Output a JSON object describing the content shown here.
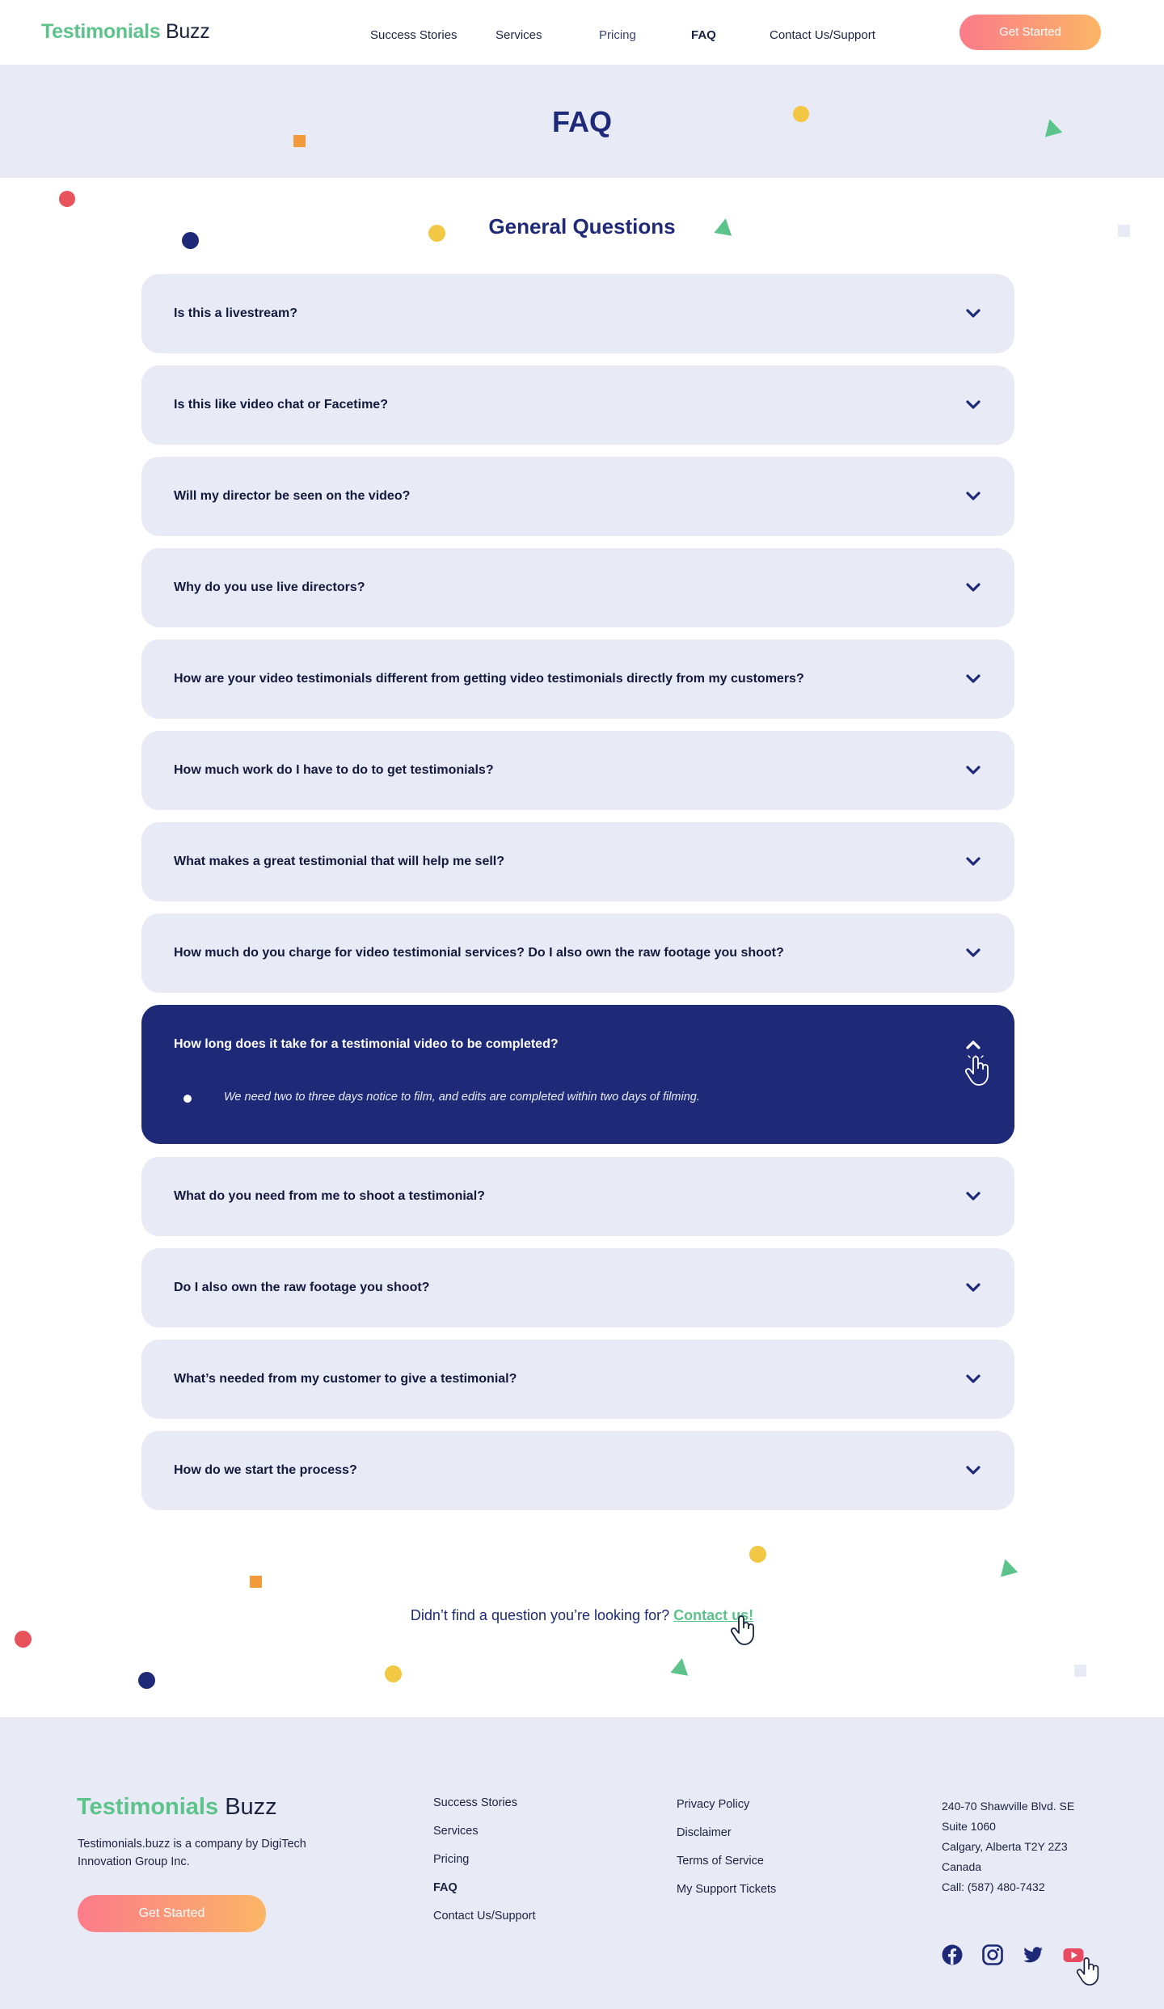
{
  "header": {
    "logo_part1": "Testimonials",
    "logo_part2": "Buzz",
    "nav": [
      {
        "label": "Success Stories"
      },
      {
        "label": "Services"
      },
      {
        "label": "Pricing"
      },
      {
        "label": "FAQ"
      },
      {
        "label": "Contact Us/Support"
      }
    ],
    "cta_label": "Get Started"
  },
  "hero": {
    "title": "FAQ"
  },
  "section_title": "General Questions",
  "faq": [
    {
      "question": "Is this a livestream?"
    },
    {
      "question": "Is this like video chat or Facetime?"
    },
    {
      "question": "Will my director be seen on the video?"
    },
    {
      "question": "Why do you use live directors?"
    },
    {
      "question": "How are your video testimonials different from getting video testimonials directly from my customers?"
    },
    {
      "question": "How much work do I have to do to get testimonials?"
    },
    {
      "question": "What makes a great testimonial that will help me sell?"
    },
    {
      "question": "How much do you charge for video testimonial services? Do I also own the raw footage you shoot?"
    },
    {
      "question": "How long does it take for a testimonial video to be completed?",
      "answer": "We need two to three days notice to film, and edits are completed within two days of filming.",
      "expanded": true
    },
    {
      "question": "What do you need from me to shoot a testimonial?"
    },
    {
      "question": "Do I also own the raw footage you shoot?"
    },
    {
      "question": "What’s needed from my customer to give a testimonial?"
    },
    {
      "question": "How do we start the process?"
    }
  ],
  "cta": {
    "text": "Didn’t find a question you’re looking for?",
    "link": "Contact us!"
  },
  "footer": {
    "logo_part1": "Testimonials",
    "logo_part2": "Buzz",
    "description": "Testimonials.buzz is a company by DigiTech Innovation Group Inc.",
    "cta_label": "Get Started",
    "nav_links": [
      "Success Stories",
      "Services",
      "Pricing",
      "FAQ",
      "Contact Us/Support"
    ],
    "legal_links": [
      "Privacy Policy",
      "Disclaimer",
      "Terms of Service",
      "My Support Tickets"
    ],
    "address": [
      "240-70 Shawville Blvd. SE",
      "Suite 1060",
      "Calgary, Alberta T2Y 2Z3",
      "Canada",
      "Call: (587) 480-7432"
    ],
    "social_icons": [
      "facebook-icon",
      "instagram-icon",
      "twitter-icon",
      "youtube-icon"
    ]
  },
  "colors": {
    "brand_green": "#5cc48a",
    "navy": "#1e2a78",
    "light_bg": "#e8eaf6",
    "gradient_start": "#fb7b8a",
    "gradient_end": "#fbb666",
    "youtube_red": "#e84a5f"
  }
}
